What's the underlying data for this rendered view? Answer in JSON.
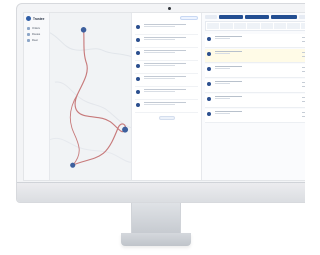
{
  "app": {
    "title": "Trustee"
  },
  "sidebar": {
    "items": [
      {
        "label": "Orders"
      },
      {
        "label": "Routes"
      },
      {
        "label": "Fleet"
      }
    ]
  },
  "colors": {
    "route": "#c7797a",
    "marker": "#3d5f9d",
    "accent": "#244f92",
    "highlight": "#fffbe7"
  },
  "map": {
    "icons": [
      "map-marker-icon",
      "route-line"
    ]
  },
  "list": {
    "items": [
      "item",
      "item",
      "item",
      "item",
      "item",
      "item",
      "item"
    ]
  },
  "panel": {
    "tasks": [
      "task",
      "task",
      "task",
      "task",
      "task",
      "task"
    ]
  }
}
